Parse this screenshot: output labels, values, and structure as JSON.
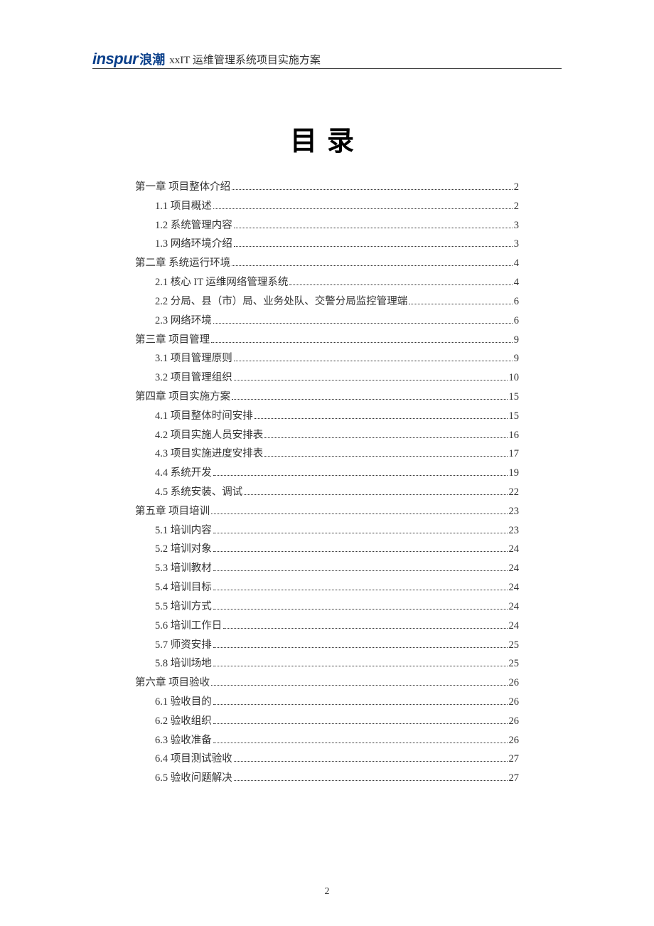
{
  "header": {
    "logo_en": "inspur",
    "logo_cn": "浪潮",
    "title": "xxIT 运维管理系统项目实施方案"
  },
  "title": "目录",
  "page_number": "2",
  "toc": [
    {
      "level": 1,
      "label": "第一章  项目整体介绍",
      "page": "2"
    },
    {
      "level": 2,
      "label": "1.1 项目概述",
      "page": "2"
    },
    {
      "level": 2,
      "label": "1.2 系统管理内容",
      "page": "3"
    },
    {
      "level": 2,
      "label": "1.3 网络环境介绍",
      "page": "3"
    },
    {
      "level": 1,
      "label": "第二章  系统运行环境",
      "page": "4"
    },
    {
      "level": 2,
      "label": "2.1 核心 IT 运维网络管理系统",
      "page": "4"
    },
    {
      "level": 2,
      "label": "2.2 分局、县（市）局、业务处队、交警分局监控管理端",
      "page": "6"
    },
    {
      "level": 2,
      "label": "2.3 网络环境",
      "page": "6"
    },
    {
      "level": 1,
      "label": "第三章  项目管理",
      "page": "9"
    },
    {
      "level": 2,
      "label": "3.1 项目管理原则",
      "page": "9"
    },
    {
      "level": 2,
      "label": "3.2 项目管理组织",
      "page": "10"
    },
    {
      "level": 1,
      "label": "第四章  项目实施方案",
      "page": "15"
    },
    {
      "level": 2,
      "label": "4.1 项目整体时间安排",
      "page": "15"
    },
    {
      "level": 2,
      "label": "4.2 项目实施人员安排表",
      "page": "16"
    },
    {
      "level": 2,
      "label": "4.3 项目实施进度安排表",
      "page": "17"
    },
    {
      "level": 2,
      "label": "4.4 系统开发",
      "page": "19"
    },
    {
      "level": 2,
      "label": "4.5 系统安装、调试",
      "page": "22"
    },
    {
      "level": 1,
      "label": "第五章  项目培训",
      "page": "23"
    },
    {
      "level": 2,
      "label": "5.1 培训内容",
      "page": "23"
    },
    {
      "level": 2,
      "label": "5.2 培训对象",
      "page": "24"
    },
    {
      "level": 2,
      "label": "5.3 培训教材",
      "page": "24"
    },
    {
      "level": 2,
      "label": "5.4 培训目标",
      "page": "24"
    },
    {
      "level": 2,
      "label": "5.5 培训方式",
      "page": "24"
    },
    {
      "level": 2,
      "label": "5.6 培训工作日",
      "page": "24"
    },
    {
      "level": 2,
      "label": "5.7 师资安排",
      "page": "25"
    },
    {
      "level": 2,
      "label": "5.8 培训场地",
      "page": "25"
    },
    {
      "level": 1,
      "label": "第六章  项目验收",
      "page": "26"
    },
    {
      "level": 2,
      "label": "6.1 验收目的",
      "page": "26"
    },
    {
      "level": 2,
      "label": "6.2 验收组织",
      "page": "26"
    },
    {
      "level": 2,
      "label": "6.3 验收准备",
      "page": "26"
    },
    {
      "level": 2,
      "label": "6.4 项目测试验收",
      "page": "27"
    },
    {
      "level": 2,
      "label": "6.5 验收问题解决",
      "page": "27"
    }
  ]
}
